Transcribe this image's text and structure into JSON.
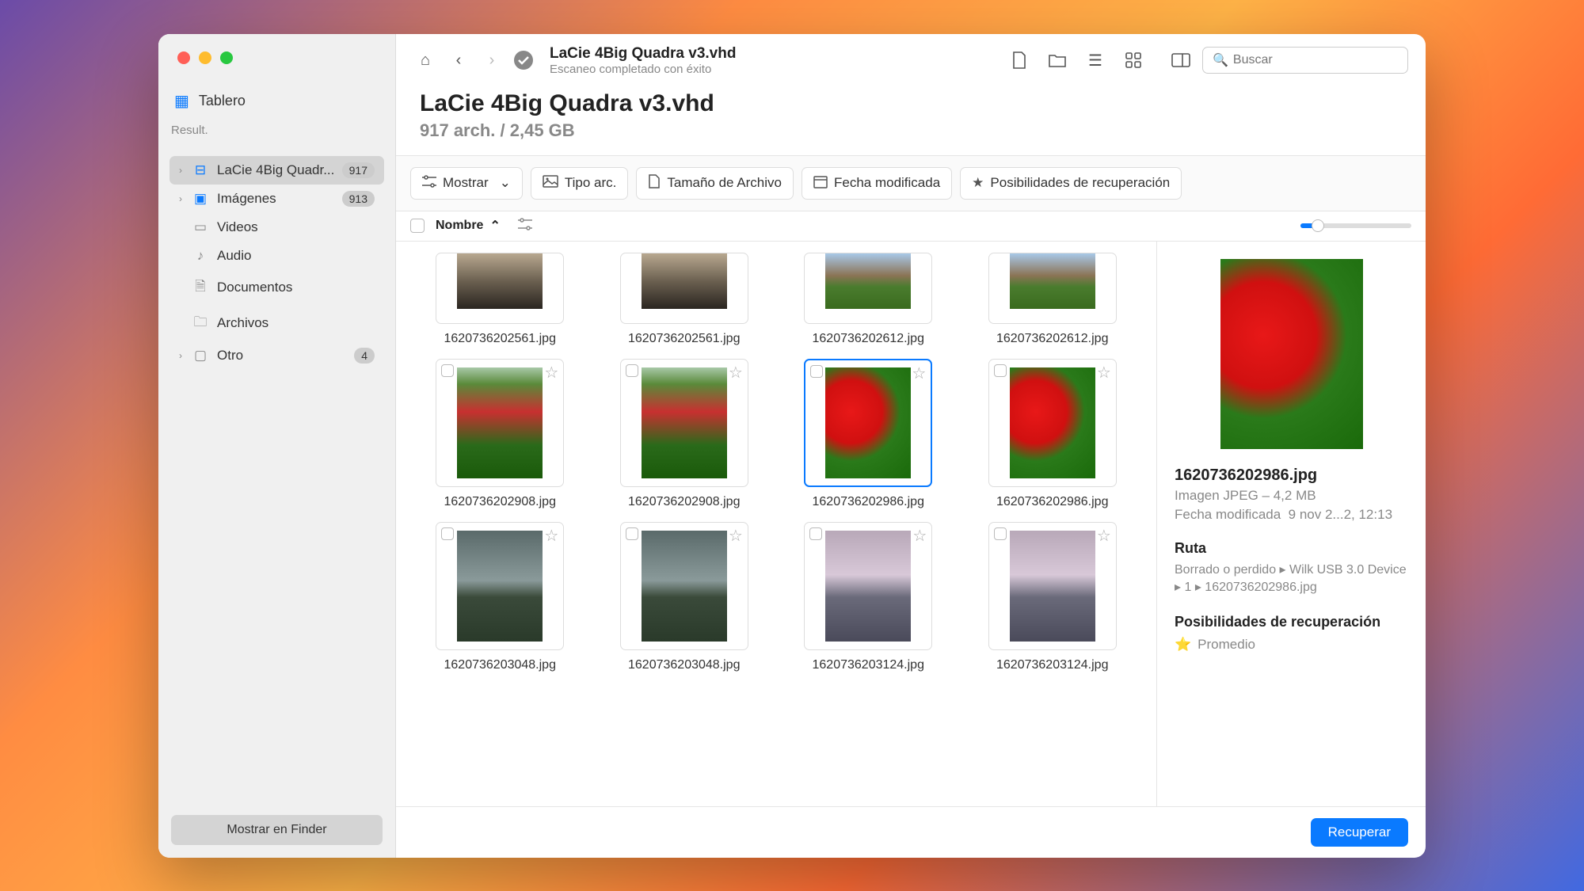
{
  "sidebar": {
    "tablero": "Tablero",
    "result_header": "Result.",
    "items": [
      {
        "label": "LaCie 4Big Quadr...",
        "badge": "917",
        "icon": "disk"
      },
      {
        "label": "Imágenes",
        "badge": "913",
        "icon": "image"
      },
      {
        "label": "Videos",
        "badge": "",
        "icon": "video"
      },
      {
        "label": "Audio",
        "badge": "",
        "icon": "audio"
      },
      {
        "label": "Documentos",
        "badge": "",
        "icon": "doc"
      },
      {
        "label": "Archivos",
        "badge": "",
        "icon": "archive"
      },
      {
        "label": "Otro",
        "badge": "4",
        "icon": "other"
      }
    ],
    "finder_btn": "Mostrar en Finder"
  },
  "toolbar": {
    "title": "LaCie 4Big Quadra v3.vhd",
    "subtitle": "Escaneo completado con éxito",
    "search_placeholder": "Buscar"
  },
  "header": {
    "title": "LaCie 4Big Quadra v3.vhd",
    "subtitle": "917 arch. / 2,45 GB"
  },
  "filters": {
    "mostrar": "Mostrar",
    "tipo": "Tipo arc.",
    "tamano": "Tamaño de Archivo",
    "fecha": "Fecha modificada",
    "posib": "Posibilidades de recuperación"
  },
  "list_header": {
    "nombre": "Nombre"
  },
  "files": [
    {
      "name": "1620736202561.jpg",
      "kind": "car-half"
    },
    {
      "name": "1620736202561.jpg",
      "kind": "car-half"
    },
    {
      "name": "1620736202612.jpg",
      "kind": "tree-half"
    },
    {
      "name": "1620736202612.jpg",
      "kind": "tree-half"
    },
    {
      "name": "1620736202908.jpg",
      "kind": "field"
    },
    {
      "name": "1620736202908.jpg",
      "kind": "field"
    },
    {
      "name": "1620736202986.jpg",
      "kind": "tulip",
      "selected": true
    },
    {
      "name": "1620736202986.jpg",
      "kind": "tulip"
    },
    {
      "name": "1620736203048.jpg",
      "kind": "sky1"
    },
    {
      "name": "1620736203048.jpg",
      "kind": "sky1"
    },
    {
      "name": "1620736203124.jpg",
      "kind": "sky2"
    },
    {
      "name": "1620736203124.jpg",
      "kind": "sky2"
    }
  ],
  "preview": {
    "filename": "1620736202986.jpg",
    "meta1": "Imagen JPEG – 4,2 MB",
    "meta2_label": "Fecha modificada",
    "meta2_value": "9 nov 2...2, 12:13",
    "ruta_label": "Ruta",
    "ruta_value": "Borrado o perdido ▸ Wilk USB 3.0 Device ▸ 1 ▸ 1620736202986.jpg",
    "posib_label": "Posibilidades de recuperación",
    "posib_value": "Promedio"
  },
  "footer": {
    "recover": "Recuperar"
  }
}
